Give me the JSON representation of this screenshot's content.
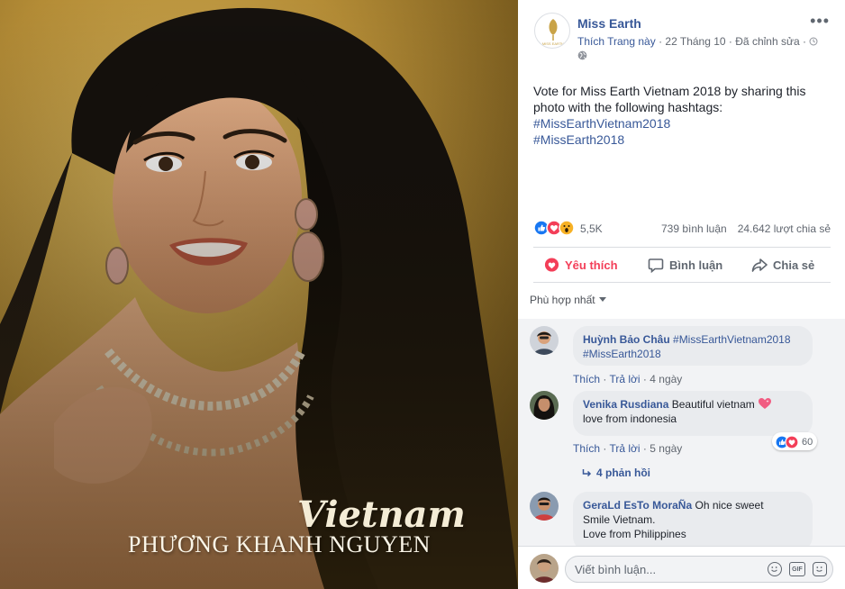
{
  "photo": {
    "country_text": "Vietnam",
    "name_text": "PHƯƠNG KHANH NGUYEN"
  },
  "post": {
    "page_name": "Miss Earth",
    "logo_text": "MISS EARTH",
    "like_page": "Thích Trang này",
    "date": "22 Tháng 10",
    "edited": "Đã chỉnh sửa",
    "text": "Vote for Miss Earth Vietnam 2018 by sharing this photo with the following hashtags:",
    "hashtags": [
      "#MissEarthVietnam2018",
      "#MissEarth2018"
    ]
  },
  "stats": {
    "reactions": "5,5K",
    "comments": "739 bình luận",
    "shares": "24.642 lượt chia sẻ"
  },
  "actions": {
    "like": "Yêu thích",
    "comment": "Bình luận",
    "share": "Chia sẻ"
  },
  "sort": {
    "label": "Phù hợp nhất"
  },
  "comments": [
    {
      "author": "Huỳnh Bảo Châu",
      "text_tag1": "#MissEarthVietnam2018",
      "text_tag2": "#MissEarth2018",
      "like": "Thích",
      "reply": "Trả lời",
      "time": "4 ngày"
    },
    {
      "author": "Venika Rusdiana",
      "text_line1": "Beautiful vietnam",
      "text_line2": "love from indonesia",
      "like": "Thích",
      "reply": "Trả lời",
      "time": "5 ngày",
      "reaction_count": "60",
      "replies": "4 phản hồi"
    },
    {
      "author": "GeraLd EsTo MoraÑa",
      "text_line1": "Oh nice sweet",
      "text_line2": "Smile Vietnam.",
      "text_line3": "Love from Philippines"
    }
  ],
  "composer": {
    "placeholder": "Viết bình luận..."
  },
  "colors": {
    "link": "#385898",
    "love": "#f33e58",
    "like": "#1877f2",
    "comment_bg": "#f2f3f5"
  }
}
